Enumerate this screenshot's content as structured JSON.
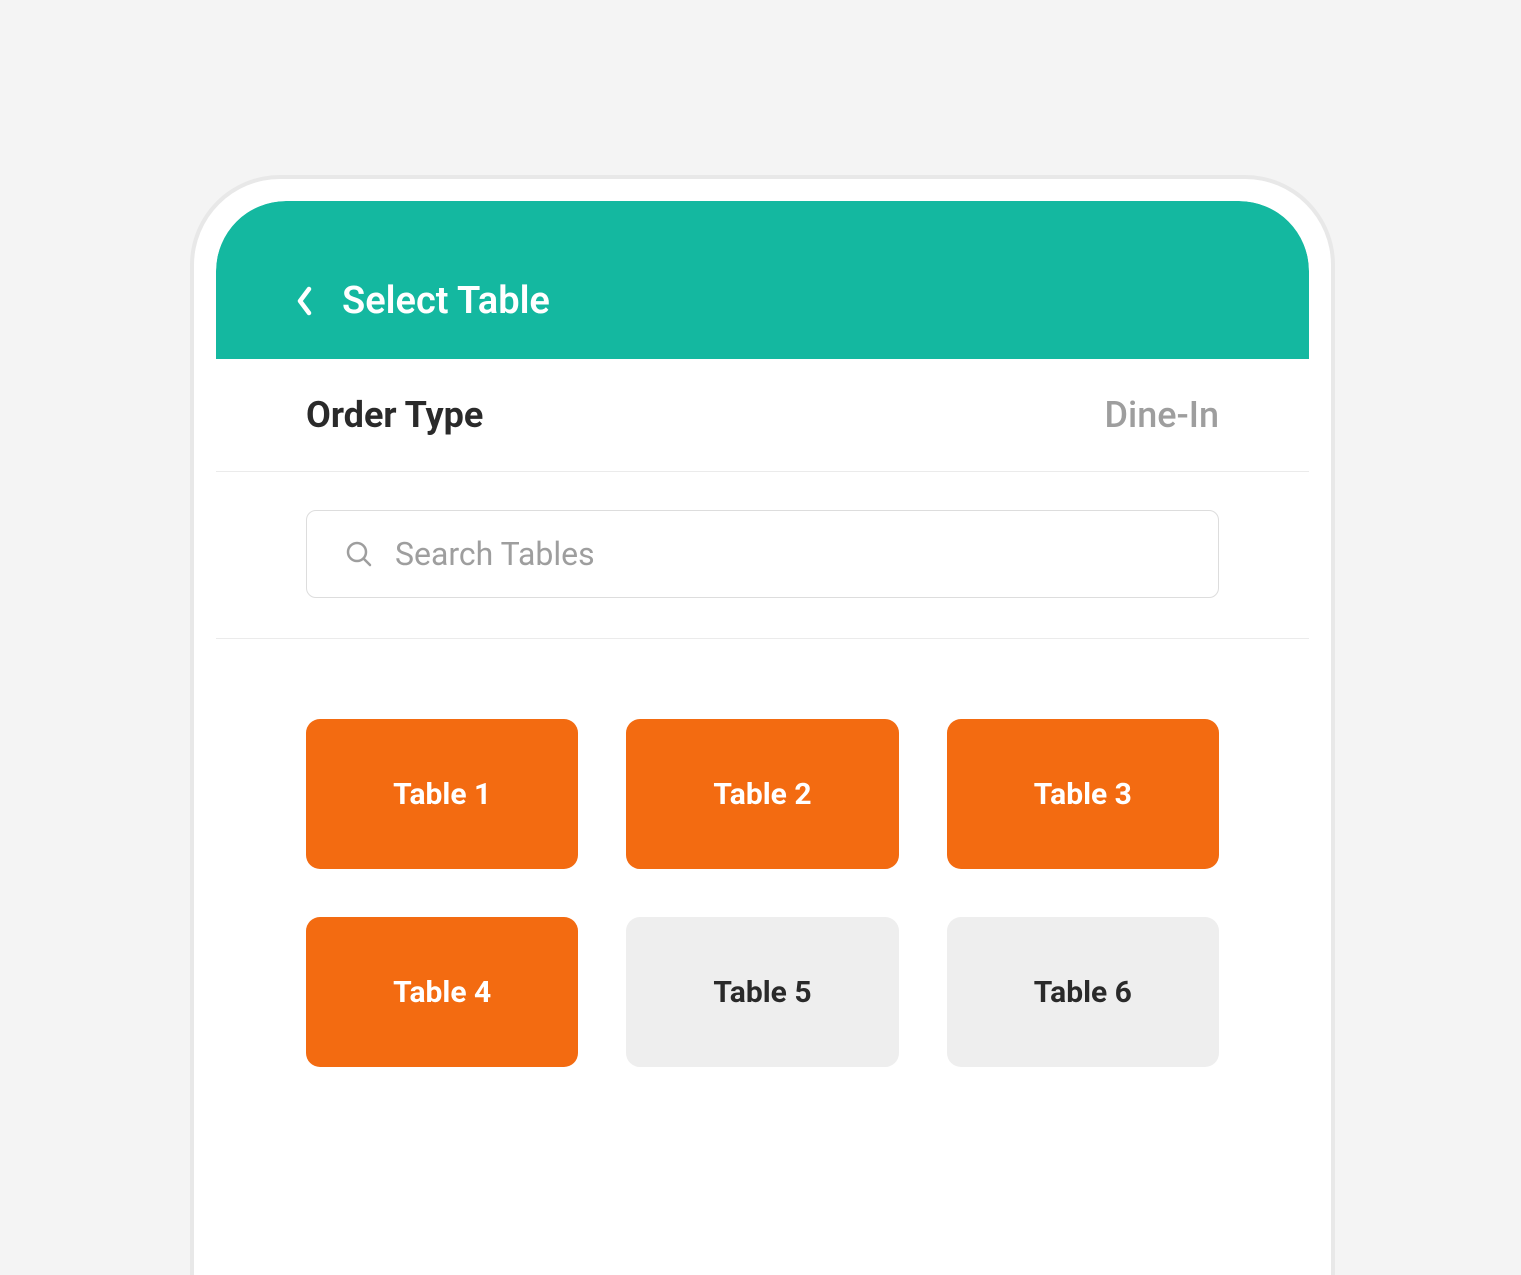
{
  "header": {
    "title": "Select Table"
  },
  "order": {
    "type_label": "Order Type",
    "type_value": "Dine-In"
  },
  "search": {
    "placeholder": "Search Tables"
  },
  "tables": [
    {
      "label": "Table 1",
      "state": "available"
    },
    {
      "label": "Table 2",
      "state": "available"
    },
    {
      "label": "Table 3",
      "state": "available"
    },
    {
      "label": "Table 4",
      "state": "available"
    },
    {
      "label": "Table 5",
      "state": "unavailable"
    },
    {
      "label": "Table 6",
      "state": "unavailable"
    }
  ],
  "colors": {
    "primary": "#14b8a0",
    "accent": "#f36b11",
    "muted": "#eeeeee"
  }
}
